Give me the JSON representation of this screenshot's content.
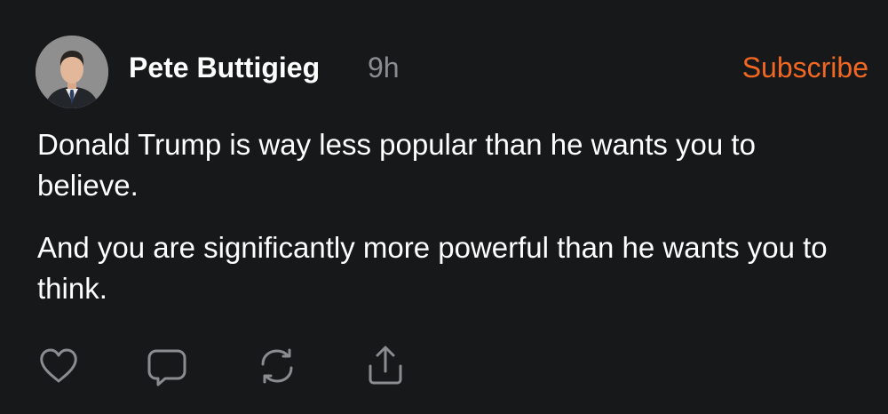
{
  "post": {
    "author": "Pete Buttigieg",
    "time_ago": "9h",
    "subscribe_label": "Subscribe",
    "paragraphs": [
      "Donald Trump is way less popular than he wants you to believe.",
      "And you are significantly more powerful than he wants you to think."
    ]
  },
  "actions": [
    {
      "icon": "heart-icon",
      "purpose": "like"
    },
    {
      "icon": "comment-bubble-icon",
      "purpose": "reply"
    },
    {
      "icon": "repost-icon",
      "purpose": "repost"
    },
    {
      "icon": "share-upload-icon",
      "purpose": "share"
    }
  ],
  "colors": {
    "background": "#161819",
    "text": "#ffffff",
    "muted": "#8a8d90",
    "accent": "#f26722"
  }
}
